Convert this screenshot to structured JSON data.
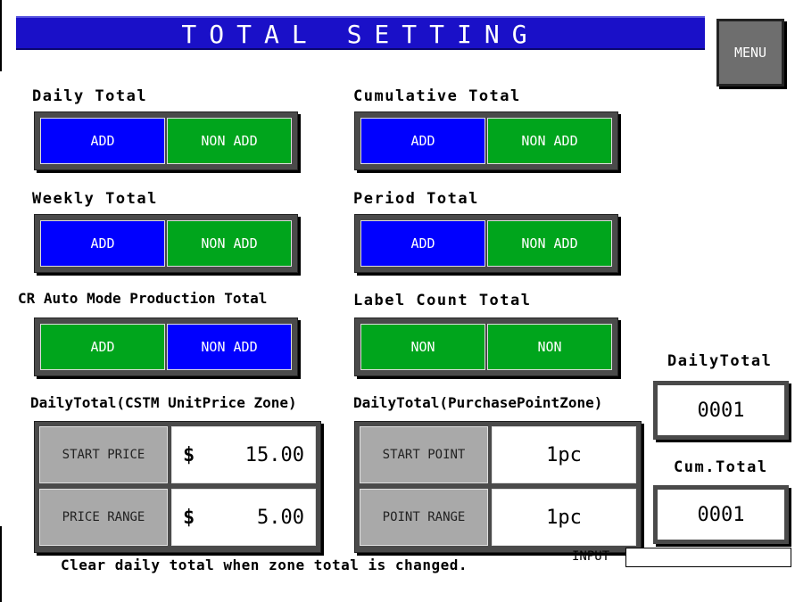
{
  "title": "TOTAL SETTING",
  "menu_label": "MENU",
  "groups": [
    {
      "label": "Daily Total",
      "left": "ADD",
      "right": "NON ADD",
      "selected": "left"
    },
    {
      "label": "Cumulative Total",
      "left": "ADD",
      "right": "NON ADD",
      "selected": "left"
    },
    {
      "label": "Weekly Total",
      "left": "ADD",
      "right": "NON ADD",
      "selected": "left"
    },
    {
      "label": "Period Total",
      "left": "ADD",
      "right": "NON ADD",
      "selected": "left"
    },
    {
      "label": "CR Auto Mode Production Total",
      "left": "ADD",
      "right": "NON ADD",
      "selected": "right"
    },
    {
      "label": "Label Count Total",
      "left": "NON",
      "right": "NON",
      "selected": "none"
    }
  ],
  "price_zone": {
    "label": "DailyTotal(CSTM UnitPrice Zone)",
    "start_caption": "START PRICE",
    "start_currency": "$",
    "start_value": "15.00",
    "range_caption": "PRICE RANGE",
    "range_currency": "$",
    "range_value": "5.00"
  },
  "point_zone": {
    "label": "DailyTotal(PurchasePointZone)",
    "start_caption": "START POINT",
    "start_value": "1pc",
    "range_caption": "POINT RANGE",
    "range_value": "1pc"
  },
  "daily_total": {
    "label": "DailyTotal",
    "value": "0001"
  },
  "cum_total": {
    "label": "Cum.Total",
    "value": "0001"
  },
  "footer_note": "Clear daily total when zone total is changed.",
  "input_label": "INPUT",
  "input_value": "",
  "colors": {
    "selected": "#0000ff",
    "unselected": "#00a51c",
    "title_bar": "#1a10c8",
    "panel": "#4a4a4a",
    "caption": "#a9a9a9"
  }
}
